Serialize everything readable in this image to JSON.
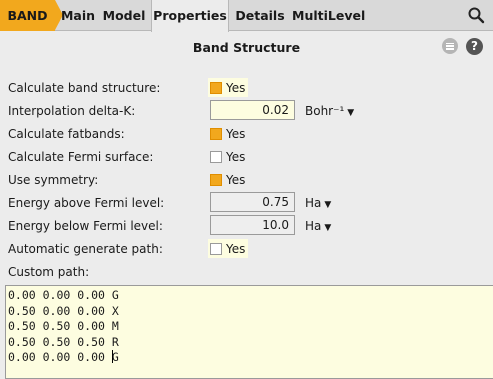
{
  "tabs": [
    {
      "label": "BAND"
    },
    {
      "label": "Main"
    },
    {
      "label": "Model"
    },
    {
      "label": "Properties"
    },
    {
      "label": "Details"
    },
    {
      "label": "MultiLevel"
    }
  ],
  "panel": {
    "title": "Band Structure",
    "help_label": "?"
  },
  "fields": {
    "calc_band": {
      "label": "Calculate band structure:",
      "value": "Yes",
      "checked": true
    },
    "interp": {
      "label": "Interpolation delta-K:",
      "value": "0.02",
      "unit": "Bohr⁻¹"
    },
    "fatbands": {
      "label": "Calculate fatbands:",
      "value": "Yes",
      "checked": true
    },
    "fermi_surface": {
      "label": "Calculate Fermi surface:",
      "value": "Yes",
      "checked": false
    },
    "symmetry": {
      "label": "Use symmetry:",
      "value": "Yes",
      "checked": true
    },
    "energy_above": {
      "label": "Energy above Fermi level:",
      "value": "0.75",
      "unit": "Ha"
    },
    "energy_below": {
      "label": "Energy below Fermi level:",
      "value": "10.0",
      "unit": "Ha"
    },
    "auto_path": {
      "label": "Automatic generate path:",
      "value": "Yes",
      "checked": false
    },
    "custom_path": {
      "label": "Custom path:",
      "lines": [
        "0.00 0.00 0.00 G",
        "0.50 0.00 0.00 X",
        "0.50 0.50 0.00 M",
        "0.50 0.50 0.50 R",
        "0.00 0.00 0.00 G"
      ]
    }
  },
  "colors": {
    "accent": "#f2a81d",
    "field_background": "#fdfde0"
  }
}
